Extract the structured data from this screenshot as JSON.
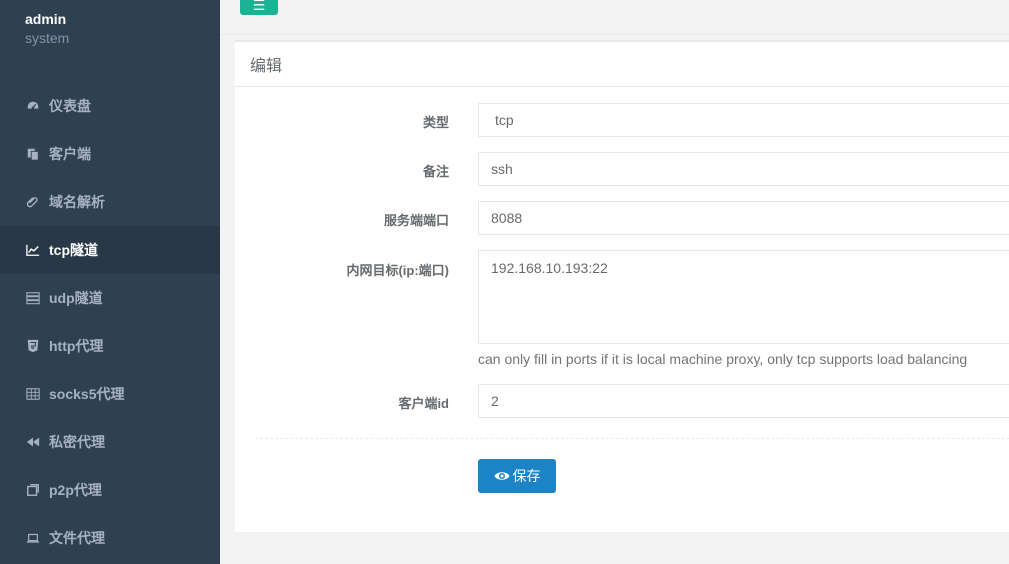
{
  "profile": {
    "name": "admin",
    "role": "system"
  },
  "nav": [
    {
      "label": "仪表盘",
      "icon": "dashboard-icon"
    },
    {
      "label": "客户端",
      "icon": "clone-icon"
    },
    {
      "label": "域名解析",
      "icon": "paperclip-icon"
    },
    {
      "label": "tcp隧道",
      "icon": "line-chart-icon",
      "active": true
    },
    {
      "label": "udp隧道",
      "icon": "server-icon"
    },
    {
      "label": "http代理",
      "icon": "html5-icon"
    },
    {
      "label": "socks5代理",
      "icon": "table-icon"
    },
    {
      "label": "私密代理",
      "icon": "backward-icon"
    },
    {
      "label": "p2p代理",
      "icon": "clone-square-icon"
    },
    {
      "label": "文件代理",
      "icon": "laptop-icon"
    }
  ],
  "panel": {
    "title": "编辑"
  },
  "form": {
    "type_label": "类型",
    "type_value": "tcp",
    "remark_label": "备注",
    "remark_value": "ssh",
    "server_port_label": "服务端端口",
    "server_port_value": "8088",
    "target_label": "内网目标(ip:端口)",
    "target_value": "192.168.10.193:22",
    "target_help": "can only fill in ports if it is local machine proxy, only tcp supports load balancing",
    "client_id_label": "客户端id",
    "client_id_value": "2",
    "save_label": "保存"
  },
  "colors": {
    "sidebar": "#2f4050",
    "accent": "#1ab394",
    "primary": "#1c84c6"
  }
}
